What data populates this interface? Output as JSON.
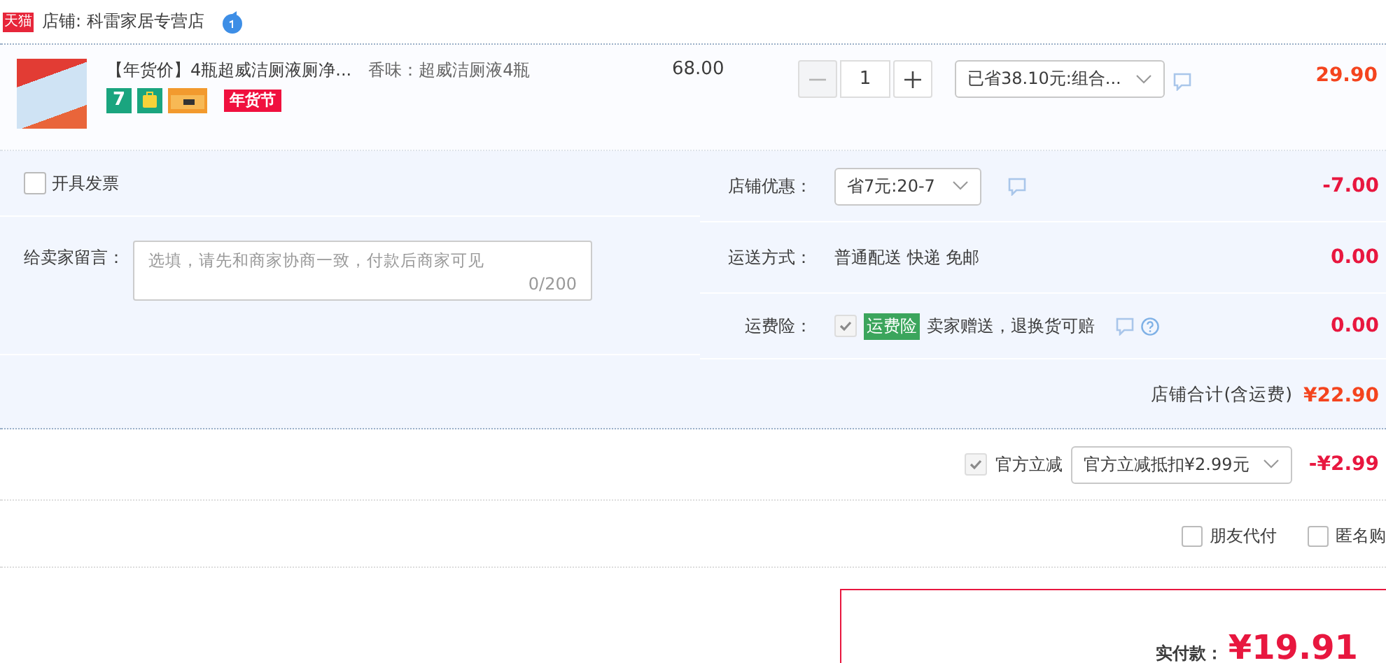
{
  "shop": {
    "badge": "天猫",
    "label": "店铺: 科雷家居专营店"
  },
  "item": {
    "title": "【年货价】4瓶超威洁厕液厕净...",
    "sku": "香味：超威洁厕液4瓶",
    "unit_price": "68.00",
    "tags": [
      {
        "kind": "number",
        "text": "7"
      },
      {
        "kind": "bag"
      },
      {
        "kind": "card"
      },
      {
        "kind": "festival",
        "text": "年货节"
      }
    ],
    "quantity": {
      "value": "1",
      "minus_disabled": true
    },
    "promo": "已省38.10元:组合...",
    "total": "29.90"
  },
  "invoice": {
    "label": "开具发票",
    "checked": false
  },
  "message": {
    "label": "给卖家留言：",
    "placeholder": "选填，请先和商家协商一致，付款后商家可见",
    "counter": "0/200"
  },
  "fees": [
    {
      "kind": "select",
      "label": "店铺优惠：",
      "value": "省7元:20-7",
      "amount": "-7.00"
    },
    {
      "kind": "text",
      "label": "运送方式：",
      "value": "普通配送 快递 免邮",
      "amount": "0.00"
    },
    {
      "kind": "insurance",
      "label": "运费险：",
      "checked": true,
      "tag": "运费险",
      "value": "卖家赠送，退换货可赔",
      "amount": "0.00"
    }
  ],
  "shop_total": {
    "label": "店铺合计(含运费)",
    "amount": "¥22.90"
  },
  "official": {
    "checked": true,
    "label": "官方立减",
    "select": "官方立减抵扣¥2.99元",
    "amount": "-¥2.99"
  },
  "options": [
    {
      "label": "朋友代付",
      "checked": false
    },
    {
      "label": "匿名购",
      "checked": false
    }
  ],
  "payment": {
    "label": "实付款：",
    "amount": "¥19.91"
  }
}
